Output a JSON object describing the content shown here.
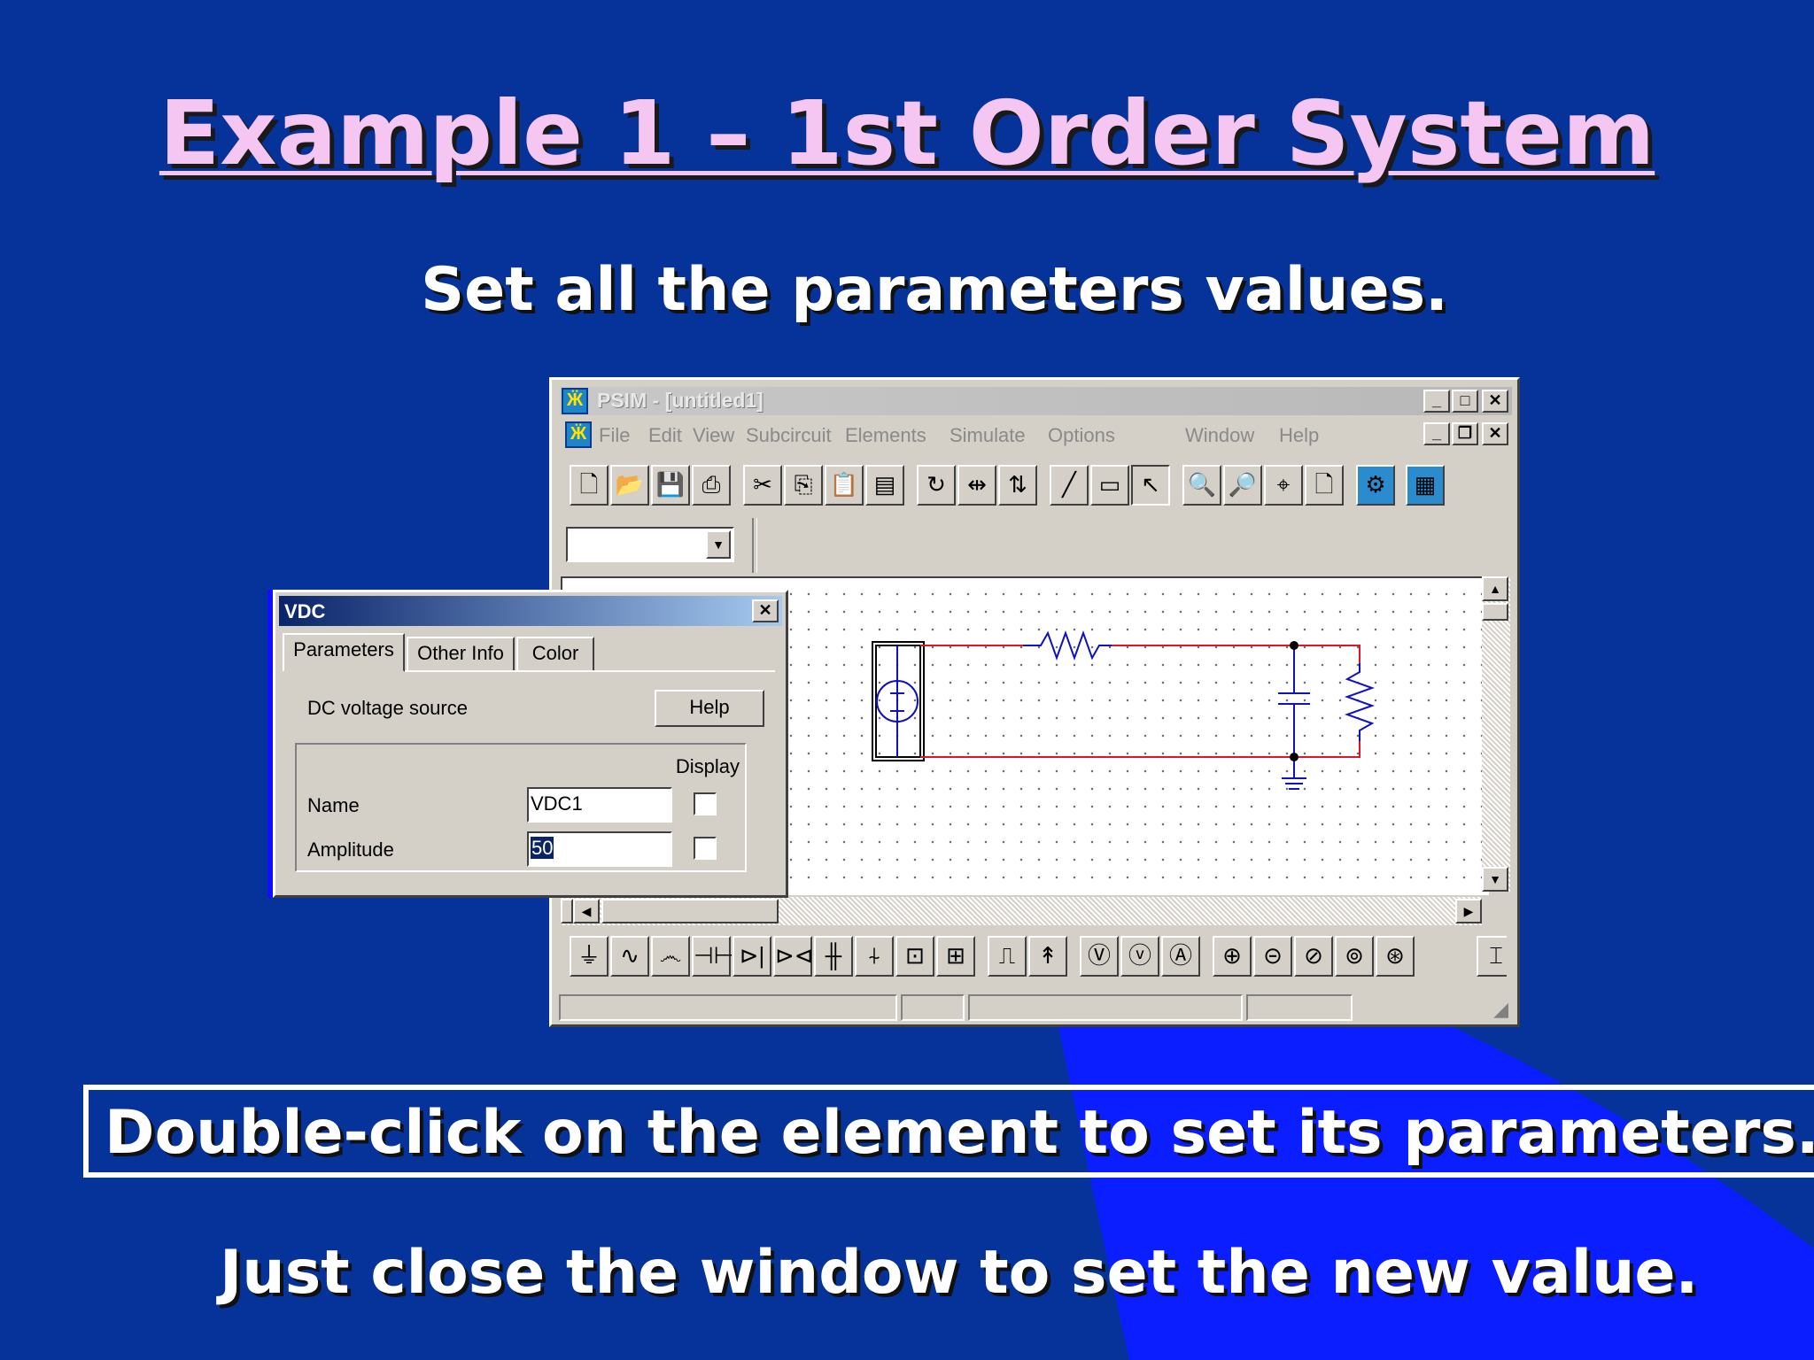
{
  "slide": {
    "title": "Example 1 – 1st Order System",
    "subtitle": "Set all the parameters values.",
    "callout": "Double-click on the element to set its parameters.",
    "note": "Just close the window to set the new value.",
    "colors": {
      "background": "#06339a",
      "title": "#f6c6f2",
      "wedge": "#0a1eff"
    }
  },
  "psim": {
    "title": "PSIM - [untitled1]",
    "menu": [
      "File",
      "Edit",
      "View",
      "Subcircuit",
      "Elements",
      "Simulate",
      "Options",
      "Window",
      "Help"
    ],
    "toolbar_icons": [
      "new-icon",
      "open-icon",
      "save-icon",
      "print-icon",
      "cut-icon",
      "copy-icon",
      "paste-icon",
      "clipboard-icon",
      "rotate-icon",
      "flip-lr-icon",
      "flip-tb-icon",
      "wire-icon",
      "label-icon",
      "pointer-icon",
      "zoom-in-icon",
      "zoom-out-icon",
      "zoom-fit-icon",
      "page-icon",
      "simulate-icon",
      "simview-icon"
    ],
    "element_icons": [
      "ground-icon",
      "resistor-icon",
      "inductor-icon",
      "capacitor-icon",
      "diode-icon",
      "thyristor-icon",
      "mosfet-icon",
      "igbt-icon",
      "switch-icon",
      "gto-icon",
      "pwm-icon",
      "probe-icon",
      "voltmeter-icon",
      "voltage-probe-icon",
      "ammeter-icon",
      "dc-source-icon",
      "ac-source-icon",
      "triangle-source-icon",
      "step-source-icon",
      "current-source-icon",
      "transformer-icon"
    ],
    "combo_value": ""
  },
  "dialog": {
    "title": "VDC",
    "tabs": [
      "Parameters",
      "Other Info",
      "Color"
    ],
    "description": "DC voltage source",
    "help_label": "Help",
    "display_label": "Display",
    "fields": [
      {
        "label": "Name",
        "value": "VDC1",
        "display": false
      },
      {
        "label": "Amplitude",
        "value": "50",
        "display": false
      }
    ],
    "close_glyph": "✕"
  }
}
